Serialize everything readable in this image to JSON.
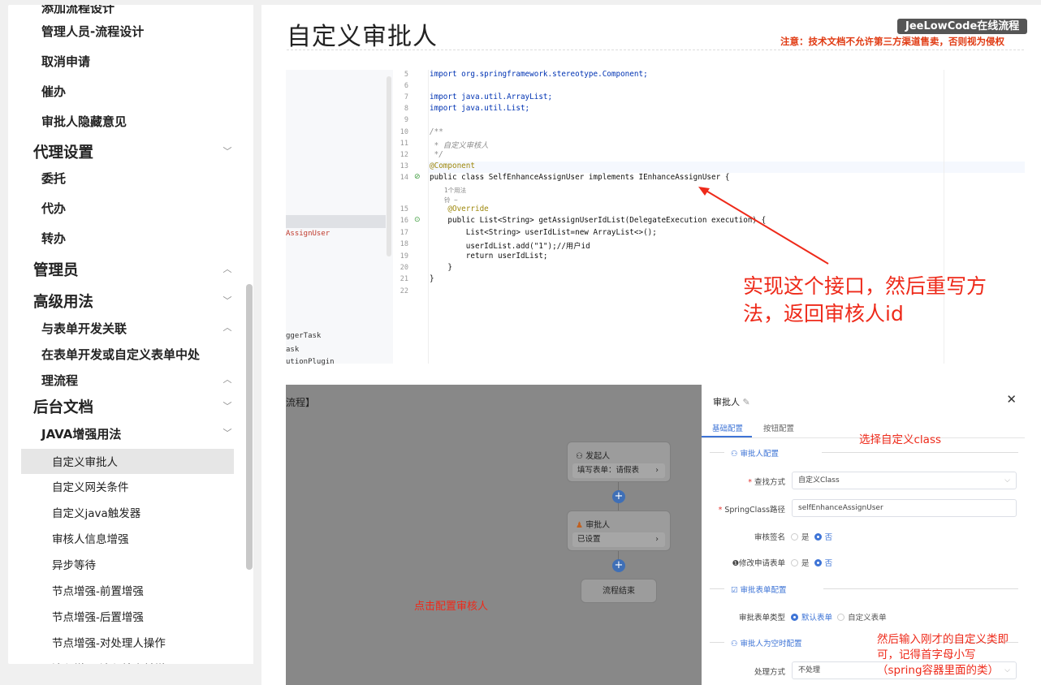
{
  "sidebar": {
    "items": [
      {
        "label": "添加流程设计",
        "level": "sub",
        "bold": true
      },
      {
        "label": "管理人员-流程设计",
        "level": "sub",
        "bold": true
      },
      {
        "label": "取消申请",
        "level": "sub",
        "bold": true
      },
      {
        "label": "催办",
        "level": "sub",
        "bold": true
      },
      {
        "label": "审批人隐藏意见",
        "level": "sub",
        "bold": true
      },
      {
        "label": "代理设置",
        "level": "group",
        "chevron": "down"
      },
      {
        "label": "委托",
        "level": "sub",
        "bold": true
      },
      {
        "label": "代办",
        "level": "sub",
        "bold": true
      },
      {
        "label": "转办",
        "level": "sub",
        "bold": true
      },
      {
        "label": "管理员",
        "level": "group",
        "chevron": "up"
      },
      {
        "label": "高级用法",
        "level": "group",
        "chevron": "down"
      },
      {
        "label": "与表单开发关联",
        "level": "sub",
        "bold": true,
        "chevron": "up"
      },
      {
        "label": "在表单开发或自定义表单中处",
        "level": "sub",
        "bold": true
      },
      {
        "label": "理流程",
        "level": "sub",
        "bold": true,
        "chevron": "up"
      },
      {
        "label": "后台文档",
        "level": "group",
        "chevron": "down"
      },
      {
        "label": "JAVA增强用法",
        "level": "sub",
        "bold": true,
        "chevron": "down"
      },
      {
        "label": "自定义审批人",
        "level": "leaf",
        "active": true
      },
      {
        "label": "自定义网关条件",
        "level": "leaf"
      },
      {
        "label": "自定义java触发器",
        "level": "leaf"
      },
      {
        "label": "审核人信息增强",
        "level": "leaf"
      },
      {
        "label": "异步等待",
        "level": "leaf"
      },
      {
        "label": "节点增强-前置增强",
        "level": "leaf"
      },
      {
        "label": "节点增强-后置增强",
        "level": "leaf"
      },
      {
        "label": "节点增强-对处理人操作",
        "level": "leaf"
      },
      {
        "label": "流程增强-流程结束前增强",
        "level": "leaf"
      }
    ]
  },
  "page": {
    "title": "自定义审批人",
    "badge": "JeeLowCode在线流程",
    "notice": "注意：技术文档不允许第三方渠道售卖，否则视为侵权"
  },
  "code_shot": {
    "project_items": [
      "AssignUser",
      "ggerTask",
      "ask",
      "utionPlugin"
    ],
    "line_numbers": [
      "5",
      "6",
      "7",
      "8",
      "9",
      "10",
      "11",
      "12",
      "13",
      "14",
      "",
      "",
      "15",
      "16",
      "17",
      "18",
      "19",
      "20",
      "21",
      "22"
    ],
    "lines": [
      "import org.springframework.stereotype.Component;",
      "",
      "import java.util.ArrayList;",
      "import java.util.List;",
      "",
      "/**",
      " * 自定义审核人",
      " */",
      "@Component",
      "public class SelfEnhanceAssignUser implements IEnhanceAssignUser {",
      "    1个用法",
      "    铃 ~",
      "    @Override",
      "    public List<String> getAssignUserIdList(DelegateExecution execution) {",
      "        List<String> userIdList=new ArrayList<>();",
      "        userIdList.add(\"1\");//用户id",
      "        return userIdList;",
      "    }",
      "}",
      ""
    ],
    "annotation": [
      "实现这个接口，然后重写方",
      "法，返回审核人id"
    ]
  },
  "flow_shot": {
    "title": "流程】",
    "start_node": {
      "head": "发起人",
      "body": "填写表单：请假表"
    },
    "approver_node": {
      "head": "审批人",
      "body": "已设置"
    },
    "end_node": "流程结束",
    "click_note": "点击配置审核人",
    "drawer": {
      "title": "审批人",
      "tabs": [
        "基础配置",
        "按钮配置"
      ],
      "section1": "审批人配置",
      "find_label": "查找方式",
      "find_value": "自定义Class",
      "class_label": "SpringClass路径",
      "class_value": "selfEnhanceAssignUser",
      "sign_label": "审核签名",
      "edit_label": "修改申请表单",
      "yes": "是",
      "no": "否",
      "section2": "审批表单配置",
      "form_type_label": "审批表单类型",
      "form_default": "默认表单",
      "form_custom": "自定义表单",
      "section3": "审批人为空时配置",
      "handle_label": "处理方式",
      "handle_value": "不处理"
    },
    "note_select": "选择自定义class",
    "note_input": [
      "然后输入刚才的自定义类即",
      "可，记得首字母小写",
      "（spring容器里面的类）"
    ]
  },
  "colors": {
    "accent": "#3e74d6",
    "annotation_red": "#ee2a1a",
    "notice_red": "#e03a12",
    "active_bg": "#e6e6e6"
  }
}
